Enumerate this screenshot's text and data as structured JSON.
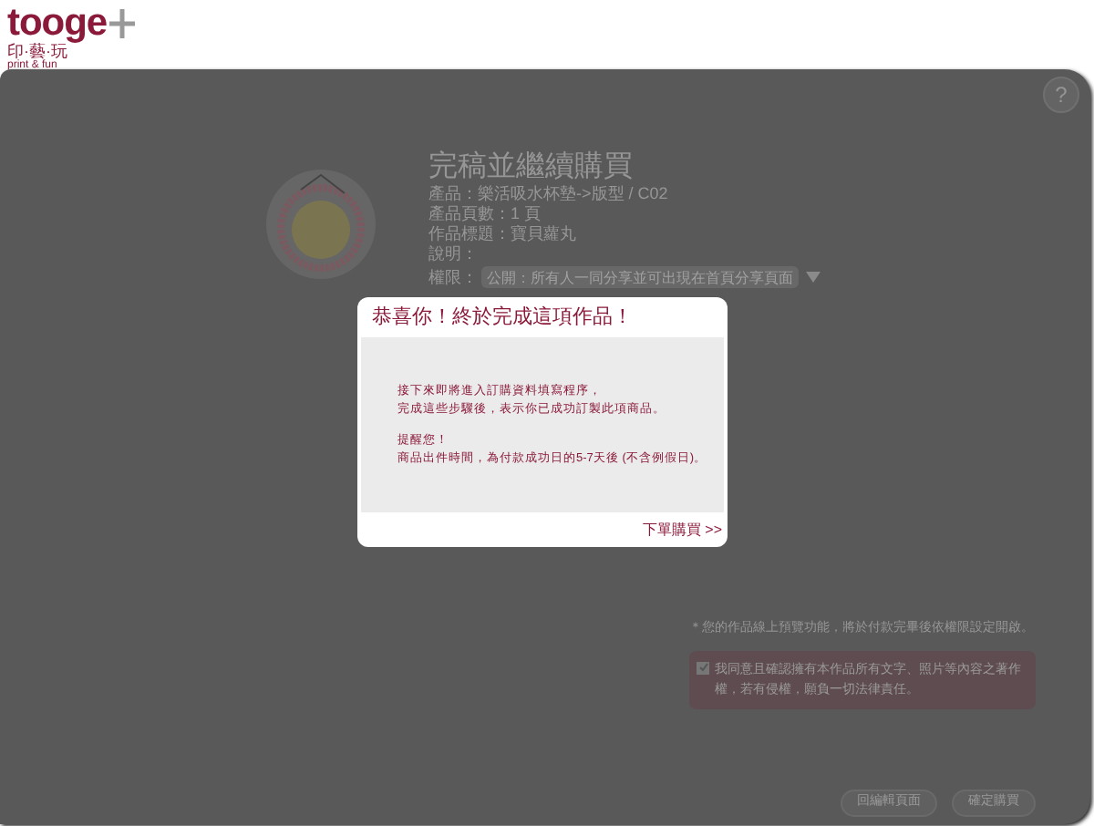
{
  "logo": {
    "wordmark": "tooge",
    "subtitle": "印·藝·玩",
    "tagline": "print & fun"
  },
  "help": {
    "label": "?"
  },
  "page": {
    "title": "完稿並繼續購買",
    "details": [
      "產品：樂活吸水杯墊->版型 / C02",
      "產品頁數：1 頁",
      "作品標題：寶貝蘿丸",
      "說明："
    ],
    "permission": {
      "label": "權限：",
      "value": "公開：所有人一同分享並可出現在首頁分享頁面"
    },
    "note": "＊您的作品線上預覽功能，將於付款完畢後依權限設定開啟。",
    "agreement": {
      "checked": true,
      "text": "我同意且確認擁有本作品所有文字、照片等內容之著作權，若有侵權，願負一切法律責任。"
    },
    "buttons": [
      "回編輯頁面",
      "確定購買"
    ]
  },
  "dialog": {
    "title": "恭喜你！終於完成這項作品！",
    "paragraphs": [
      [
        "接下來即將進入訂購資料填寫程序，",
        "完成這些步驟後，表示你已成功訂製此項商品。"
      ],
      [
        "提醒您！",
        "商品出件時間，為付款成功日的5-7天後 (不含例假日)。"
      ]
    ],
    "link": "下單購買 >>"
  }
}
